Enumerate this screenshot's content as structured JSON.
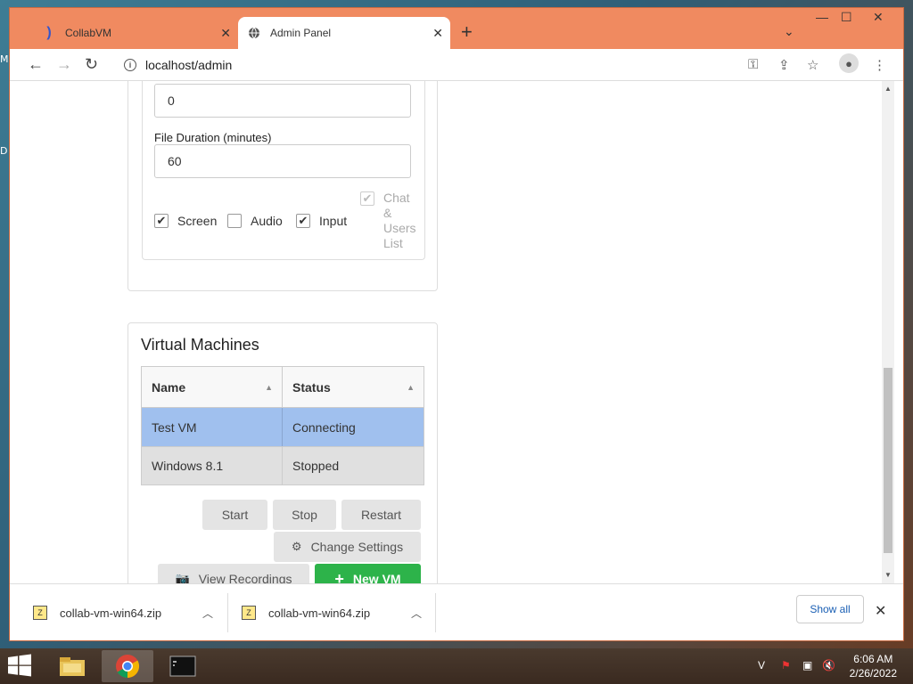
{
  "browser": {
    "tabs": [
      {
        "label": "CollabVM",
        "active": false
      },
      {
        "label": "Admin Panel",
        "active": true
      }
    ],
    "url": "localhost/admin"
  },
  "recording_settings": {
    "partial_value": "0",
    "file_duration_label": "File Duration (minutes)",
    "file_duration_value": "60",
    "checkboxes": [
      {
        "label": "Screen",
        "checked": true
      },
      {
        "label": "Audio",
        "checked": false
      },
      {
        "label": "Input",
        "checked": true
      },
      {
        "label": "Chat & Users List",
        "checked": true,
        "disabled": true
      }
    ],
    "chat_lines": [
      "Chat",
      "&",
      "Users",
      "List"
    ]
  },
  "virtual_machines": {
    "title": "Virtual Machines",
    "columns": [
      "Name",
      "Status"
    ],
    "rows": [
      {
        "name": "Test VM",
        "status": "Connecting",
        "selected": true
      },
      {
        "name": "Windows 8.1",
        "status": "Stopped",
        "selected": false
      }
    ],
    "buttons": {
      "start": "Start",
      "stop": "Stop",
      "restart": "Restart",
      "change_settings": "Change Settings",
      "view_recordings": "View Recordings",
      "new_vm": "New VM"
    }
  },
  "downloads": {
    "items": [
      "collab-vm-win64.zip",
      "collab-vm-win64.zip"
    ],
    "show_all": "Show all"
  },
  "taskbar": {
    "time": "6:06 AM",
    "date": "2/26/2022"
  },
  "desktop_letters": [
    "M",
    "D"
  ],
  "colors": {
    "selected_row": "#a0c0ee",
    "new_vm_button": "#2db34a",
    "titlebar": "#f08a60"
  }
}
